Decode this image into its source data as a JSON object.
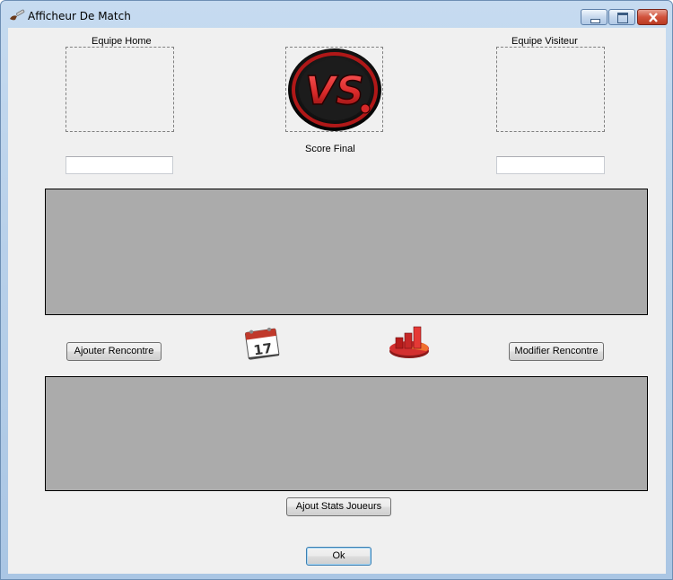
{
  "window": {
    "title": "Afficheur De Match",
    "app_icon": "brush-icon",
    "controls": [
      "minimize",
      "maximize",
      "close"
    ]
  },
  "home": {
    "label": "Equipe Home",
    "score": ""
  },
  "visitor": {
    "label": "Equipe Visiteur",
    "score": ""
  },
  "center": {
    "logo_text": "VS",
    "score_label": "Score Final"
  },
  "buttons": {
    "add_match": "Ajouter Rencontre",
    "edit_match": "Modifier Rencontre",
    "add_player_stats": "Ajout Stats Joueurs",
    "ok": "Ok"
  },
  "icons": {
    "calendar_day": "17",
    "calendar": "calendar-icon",
    "stats": "chart-icon"
  },
  "colors": {
    "grid_background": "#ababab",
    "form_background": "#f0f0f0",
    "vs_red": "#d62828"
  }
}
